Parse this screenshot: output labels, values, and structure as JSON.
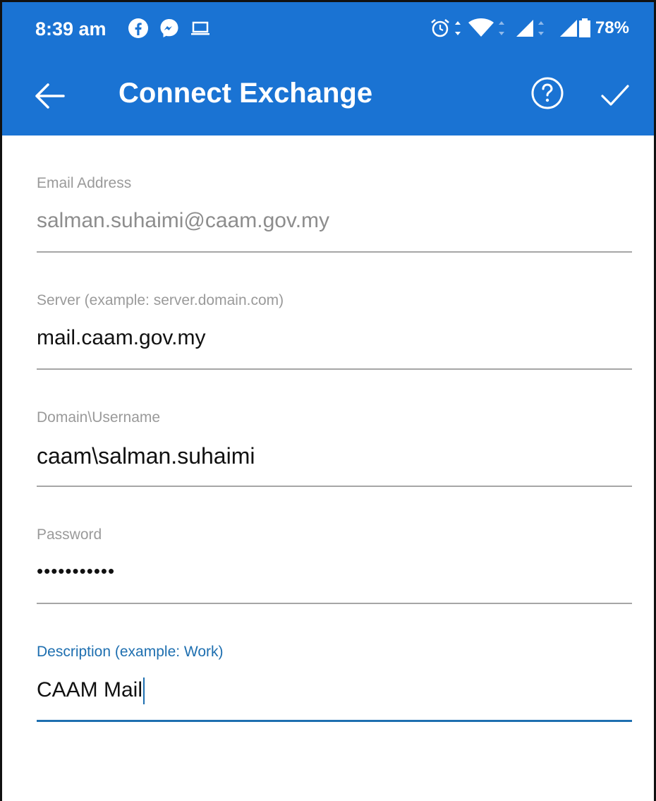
{
  "status_bar": {
    "time": "8:39 am",
    "battery": "78%",
    "icons": [
      "facebook-icon",
      "messenger-icon",
      "laptop-icon",
      "alarm-icon",
      "data-arrows-icon",
      "wifi-icon",
      "signal-icon",
      "signal-icon",
      "battery-icon"
    ]
  },
  "toolbar": {
    "title": "Connect Exchange",
    "icons": [
      "back-arrow-icon",
      "help-icon",
      "checkmark-icon"
    ]
  },
  "form": {
    "email": {
      "label": "Email Address",
      "value": "salman.suhaimi@caam.gov.my"
    },
    "server": {
      "label": "Server (example: server.domain.com)",
      "value": "mail.caam.gov.my"
    },
    "username": {
      "label": "Domain\\Username",
      "value": "caam\\salman.suhaimi"
    },
    "password": {
      "label": "Password",
      "value": "•••••••••••"
    },
    "description": {
      "label": "Description (example: Work)",
      "value": "CAAM Mail"
    }
  },
  "colors": {
    "accent": "#1a73d3",
    "focus": "#1e6fb0"
  }
}
